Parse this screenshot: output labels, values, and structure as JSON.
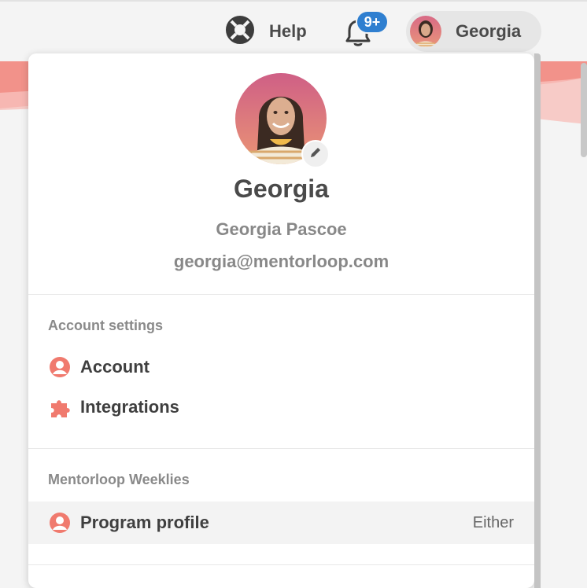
{
  "header": {
    "help_label": "Help",
    "notification_badge": "9+",
    "user_pill_name": "Georgia"
  },
  "profile": {
    "display_name": "Georgia",
    "full_name": "Georgia Pascoe",
    "email": "georgia@mentorloop.com"
  },
  "account_settings": {
    "heading": "Account settings",
    "items": [
      {
        "label": "Account",
        "icon": "user-circle-icon"
      },
      {
        "label": "Integrations",
        "icon": "puzzle-piece-icon"
      }
    ]
  },
  "weeklies": {
    "heading": "Mentorloop Weeklies",
    "items": [
      {
        "label": "Program profile",
        "icon": "user-circle-icon",
        "value": "Either"
      }
    ]
  },
  "colors": {
    "accent": "#f07a6e",
    "badge": "#2f7fd0"
  }
}
